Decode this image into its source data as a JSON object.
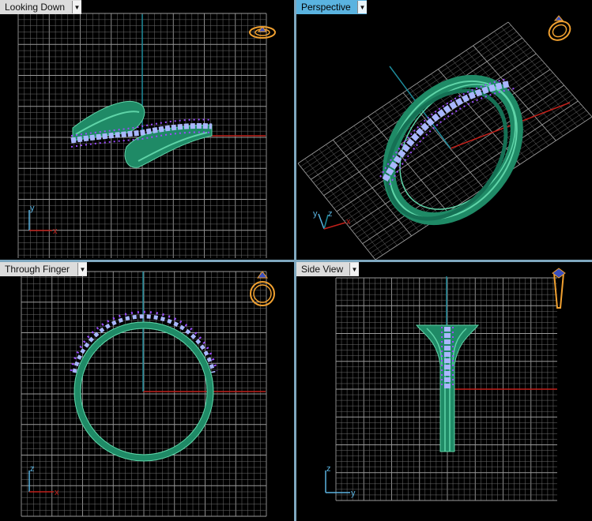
{
  "viewports": {
    "top": {
      "label": "Looking Down",
      "active": false
    },
    "perspective": {
      "label": "Perspective",
      "active": true
    },
    "front": {
      "label": "Through Finger",
      "active": false
    },
    "side": {
      "label": "Side View",
      "active": false
    }
  },
  "axes": {
    "top": {
      "a": "y",
      "b": "x"
    },
    "perspective": {
      "a": "y",
      "b": "z",
      "c": "x"
    },
    "front": {
      "a": "z",
      "b": "x"
    },
    "side": {
      "a": "z",
      "b": "y"
    }
  },
  "colors": {
    "grid": "#6e6e6e",
    "grid_major": "#9a9a9a",
    "axis_x": "#c0201a",
    "axis_vertical": "#1e8a9a",
    "ring_metal": "#1f8a66",
    "ring_highlight": "#5fd4a8",
    "gems": "#a9b7ff",
    "prongs": "#9b4dff",
    "icon": "#f0a030",
    "active_tab": "#5ab3e0",
    "divider": "#7fa8c0"
  },
  "icons": {
    "top": "ring-top-icon",
    "perspective": "ring-perspective-icon",
    "front": "ring-front-icon",
    "side": "ring-side-icon"
  }
}
